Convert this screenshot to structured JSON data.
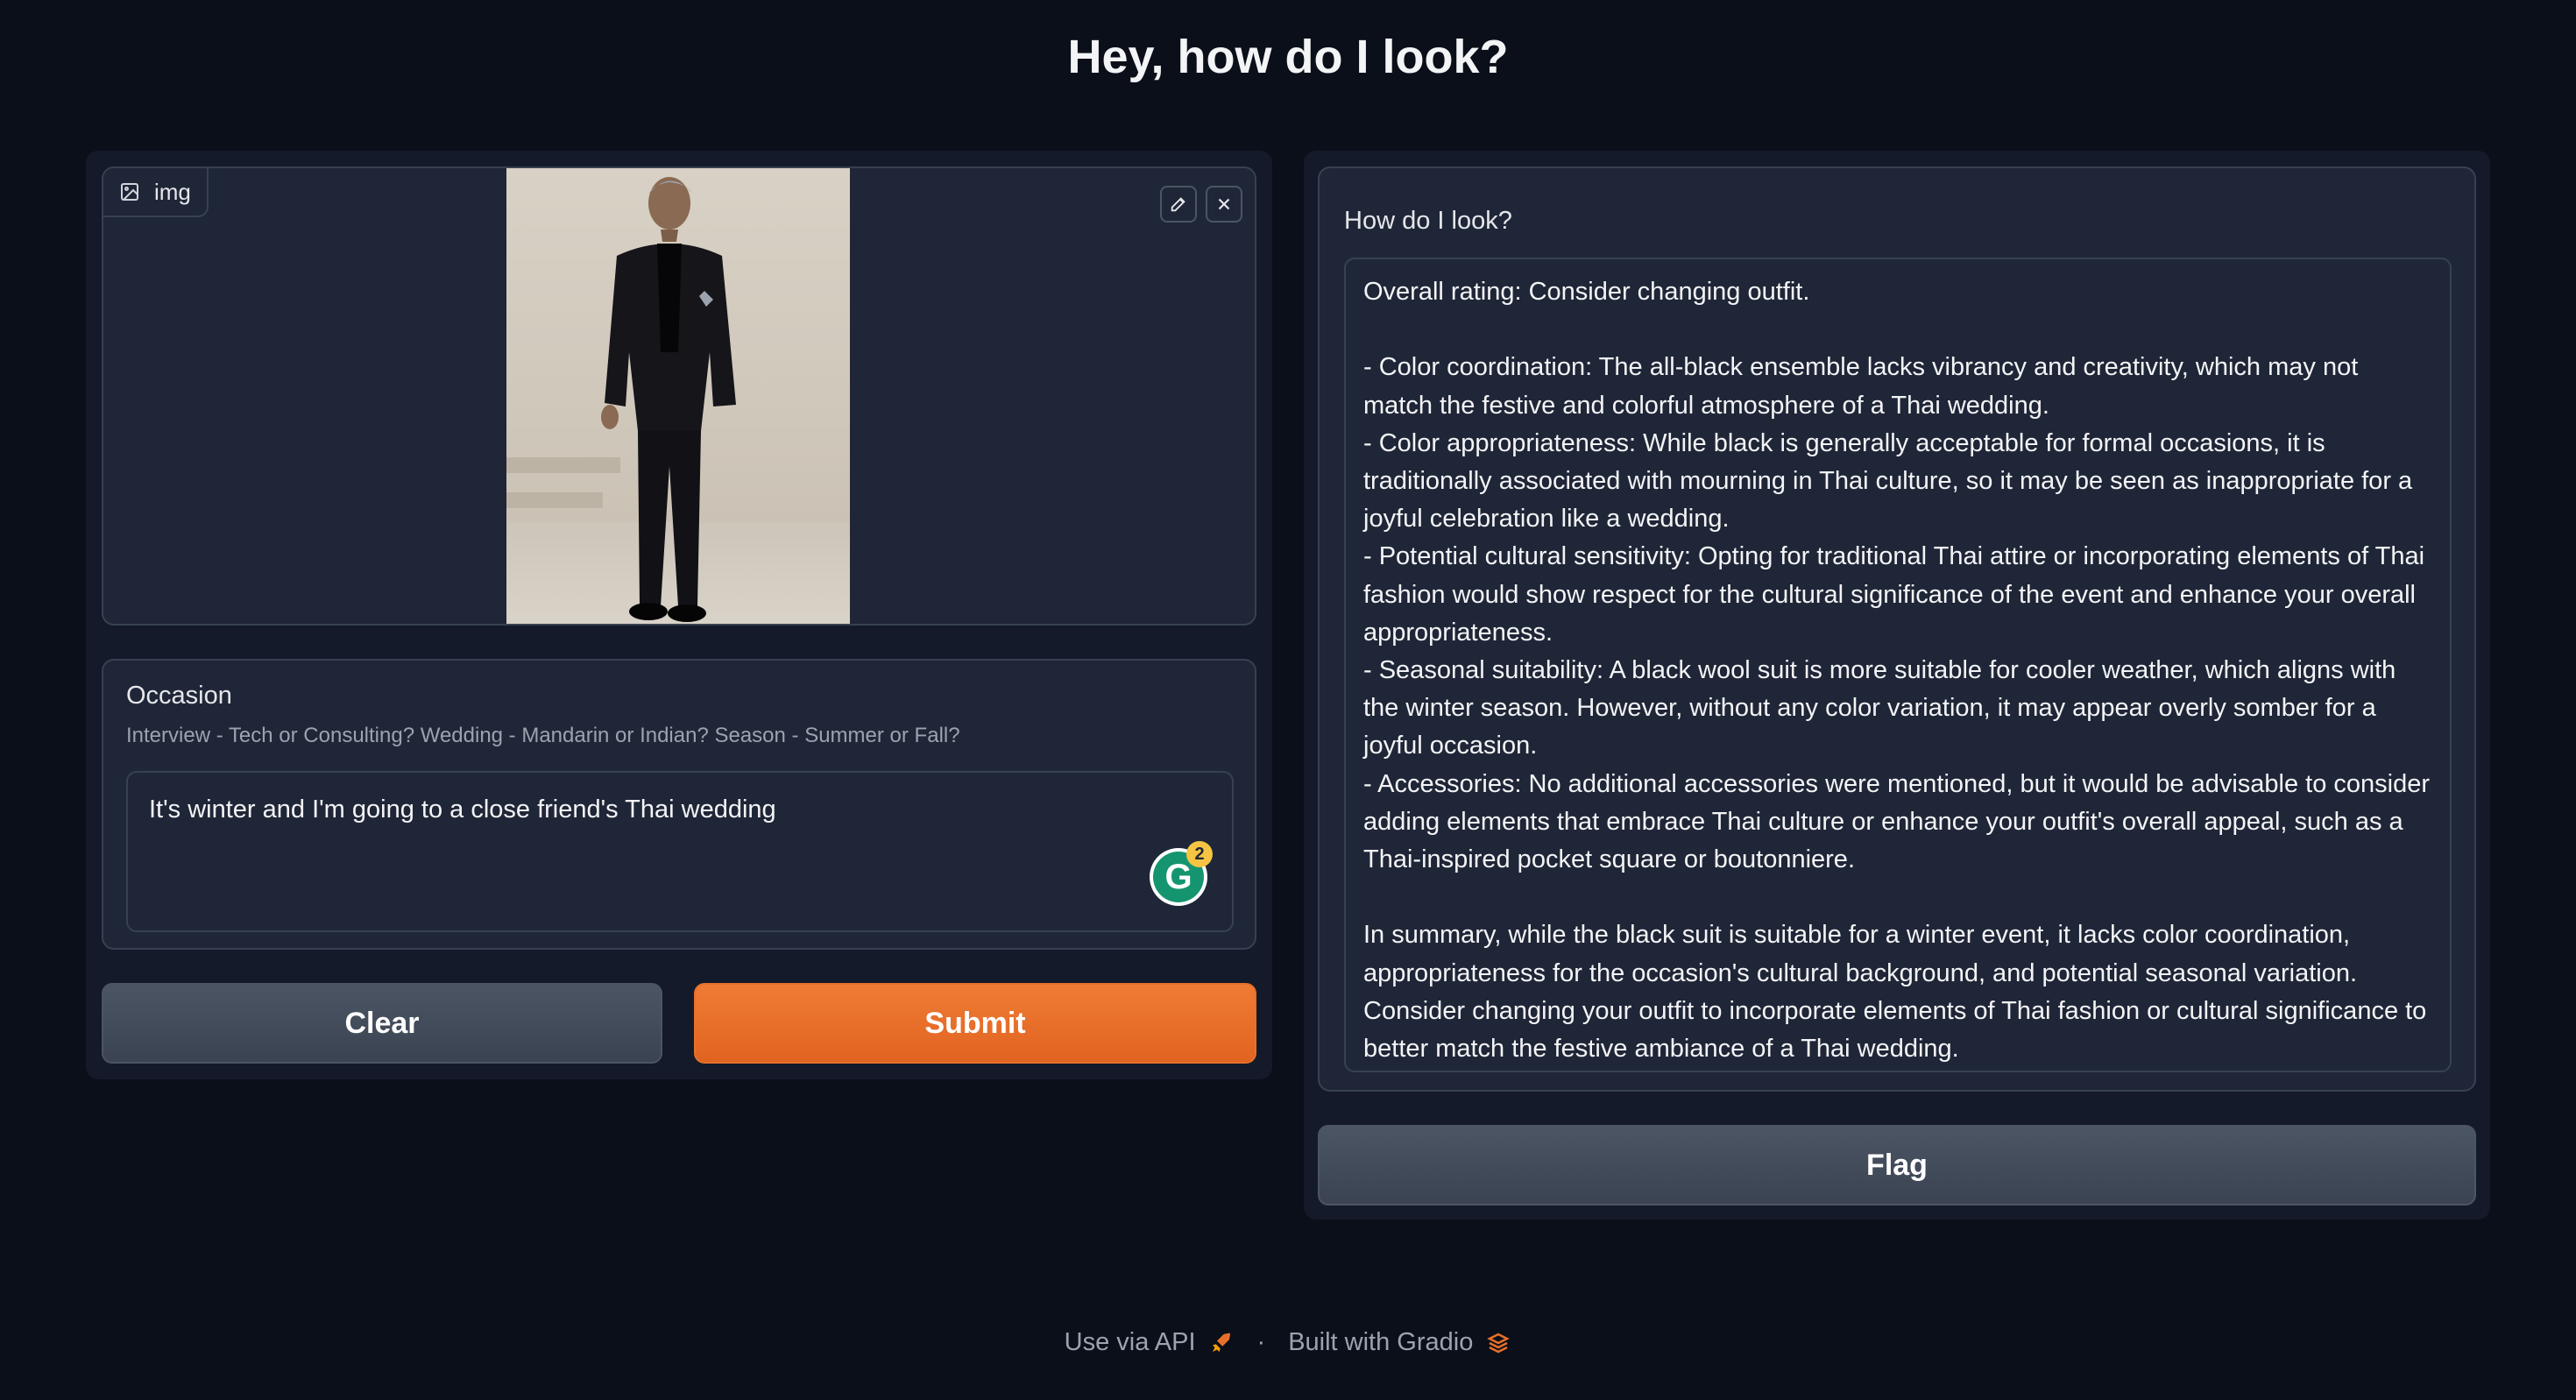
{
  "page": {
    "title": "Hey, how do I look?"
  },
  "image_input": {
    "label": "img"
  },
  "occasion": {
    "label": "Occasion",
    "info": "Interview - Tech or Consulting? Wedding - Mandarin or Indian? Season - Summer or Fall?",
    "value": "It's winter and I'm going to a close friend's Thai wedding",
    "grammarly_count": "2"
  },
  "buttons": {
    "clear": "Clear",
    "submit": "Submit",
    "flag": "Flag"
  },
  "output": {
    "label": "How do I look?",
    "text": "Overall rating: Consider changing outfit.\n\n- Color coordination: The all-black ensemble lacks vibrancy and creativity, which may not match the festive and colorful atmosphere of a Thai wedding.\n- Color appropriateness: While black is generally acceptable for formal occasions, it is traditionally associated with mourning in Thai culture, so it may be seen as inappropriate for a joyful celebration like a wedding.\n- Potential cultural sensitivity: Opting for traditional Thai attire or incorporating elements of Thai fashion would show respect for the cultural significance of the event and enhance your overall appropriateness.\n- Seasonal suitability: A black wool suit is more suitable for cooler weather, which aligns with the winter season. However, without any color variation, it may appear overly somber for a joyful occasion.\n- Accessories: No additional accessories were mentioned, but it would be advisable to consider adding elements that embrace Thai culture or enhance your outfit's overall appeal, such as a Thai-inspired pocket square or boutonniere.\n\nIn summary, while the black suit is suitable for a winter event, it lacks color coordination, appropriateness for the occasion's cultural background, and potential seasonal variation. Consider changing your outfit to incorporate elements of Thai fashion or cultural significance to better match the festive ambiance of a Thai wedding."
  },
  "footer": {
    "api": "Use via API",
    "separator": "·",
    "built": "Built with Gradio"
  },
  "colors": {
    "background": "#0b0f19",
    "panel": "#1f2637",
    "accent": "#e8702a",
    "secondary_button": "#4b5563"
  }
}
